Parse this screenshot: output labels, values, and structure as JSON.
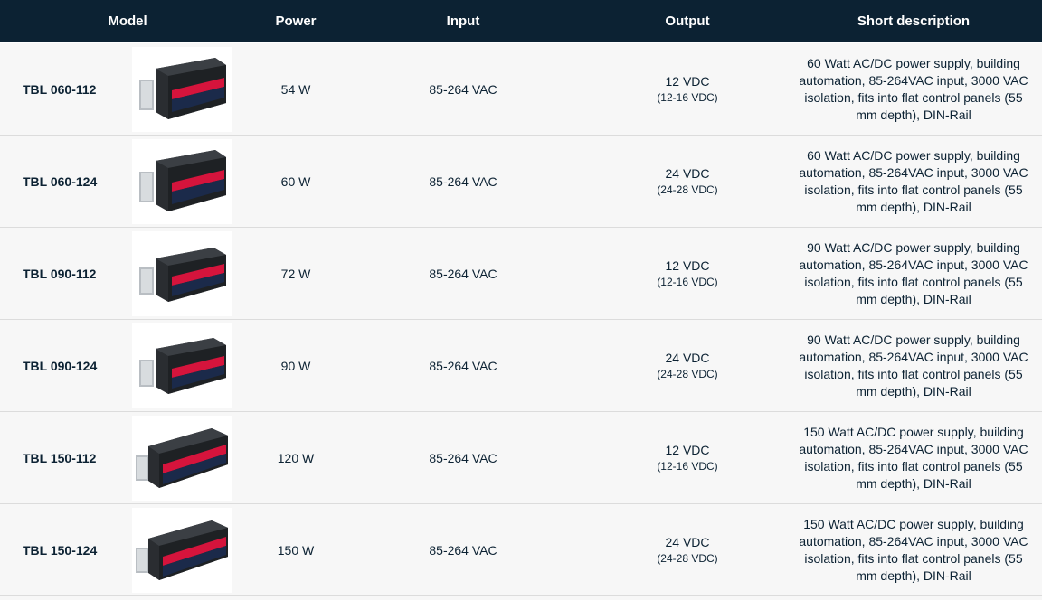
{
  "header": {
    "model": "Model",
    "power": "Power",
    "input": "Input",
    "output": "Output",
    "description": "Short description"
  },
  "rows": [
    {
      "model": "TBL 060-112",
      "power": "54 W",
      "input": "85-264 VAC",
      "output_main": "12 VDC",
      "output_range": "(12-16 VDC)",
      "description": "60 Watt AC/DC power supply, building automation, 85-264VAC input, 3000 VAC isolation, fits into flat control panels (55 mm depth), DIN-Rail"
    },
    {
      "model": "TBL 060-124",
      "power": "60 W",
      "input": "85-264 VAC",
      "output_main": "24 VDC",
      "output_range": "(24-28 VDC)",
      "description": "60 Watt AC/DC power supply, building automation, 85-264VAC input, 3000 VAC isolation, fits into flat control panels (55 mm depth), DIN-Rail"
    },
    {
      "model": "TBL 090-112",
      "power": "72 W",
      "input": "85-264 VAC",
      "output_main": "12 VDC",
      "output_range": "(12-16 VDC)",
      "description": "90 Watt AC/DC power supply, building automation, 85-264VAC input, 3000 VAC isolation, fits into flat control panels (55 mm depth), DIN-Rail"
    },
    {
      "model": "TBL 090-124",
      "power": "90 W",
      "input": "85-264 VAC",
      "output_main": "24 VDC",
      "output_range": "(24-28 VDC)",
      "description": "90 Watt AC/DC power supply, building automation, 85-264VAC input, 3000 VAC isolation, fits into flat control panels (55 mm depth), DIN-Rail"
    },
    {
      "model": "TBL 150-112",
      "power": "120 W",
      "input": "85-264 VAC",
      "output_main": "12 VDC",
      "output_range": "(12-16 VDC)",
      "description": "150 Watt AC/DC power supply, building automation, 85-264VAC input, 3000 VAC isolation, fits into flat control panels (55 mm depth), DIN-Rail"
    },
    {
      "model": "TBL 150-124",
      "power": "150 W",
      "input": "85-264 VAC",
      "output_main": "24 VDC",
      "output_range": "(24-28 VDC)",
      "description": "150 Watt AC/DC power supply, building automation, 85-264VAC input, 3000 VAC isolation, fits into flat control panels (55 mm depth), DIN-Rail"
    }
  ],
  "icons": {
    "product": "din-rail-power-supply-icon"
  },
  "colors": {
    "header_bg": "#0c2233",
    "text": "#0c2233",
    "row_bg": "#f7f7f7",
    "label_red": "#d5143c"
  }
}
